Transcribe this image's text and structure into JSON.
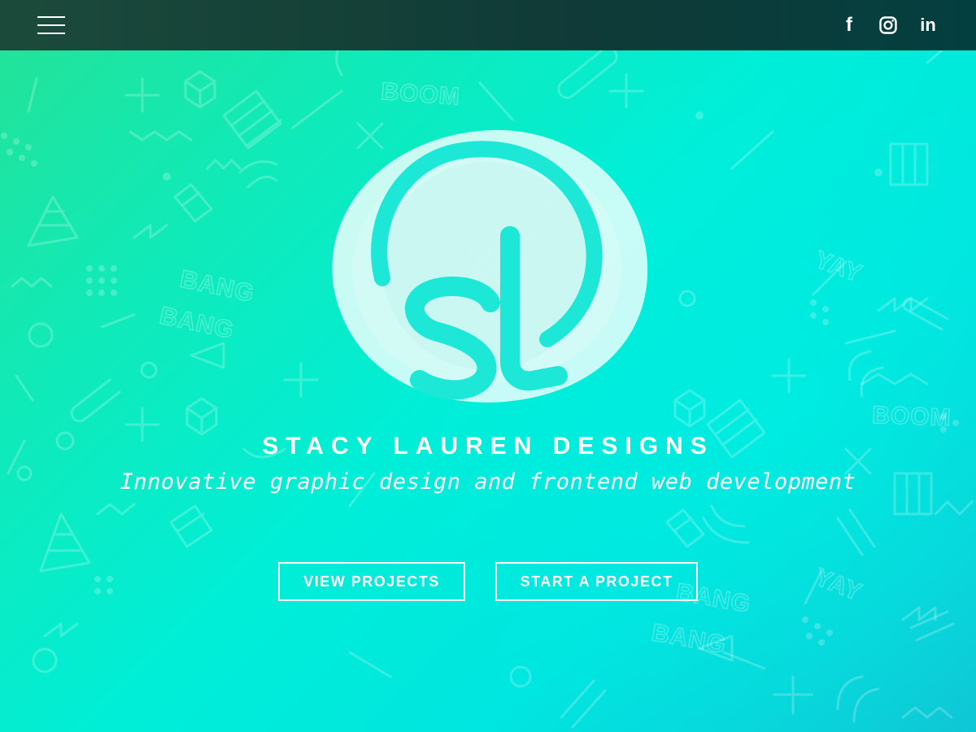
{
  "nav": {
    "menu_icon": "hamburger-menu-icon",
    "social": [
      {
        "icon": "facebook-icon",
        "glyph": "f"
      },
      {
        "icon": "instagram-icon"
      },
      {
        "icon": "linkedin-icon",
        "glyph": "in"
      }
    ]
  },
  "hero": {
    "logo_text": "sl",
    "title": "STACY LAUREN DESIGNS",
    "tagline": "Innovative graphic design and frontend web development",
    "buttons": {
      "view_projects": "VIEW PROJECTS",
      "start_project": "START A PROJECT"
    },
    "pattern_words": [
      "BOOM",
      "BANG",
      "BANG",
      "YAY",
      "BOOM",
      "YAY",
      "BANG",
      "BANG"
    ]
  },
  "colors": {
    "topbar": "#0f3a37",
    "gradient_start": "#22e39a",
    "gradient_end": "#0fc6d6",
    "accent": "#1de8d8",
    "text": "#ffffff"
  }
}
